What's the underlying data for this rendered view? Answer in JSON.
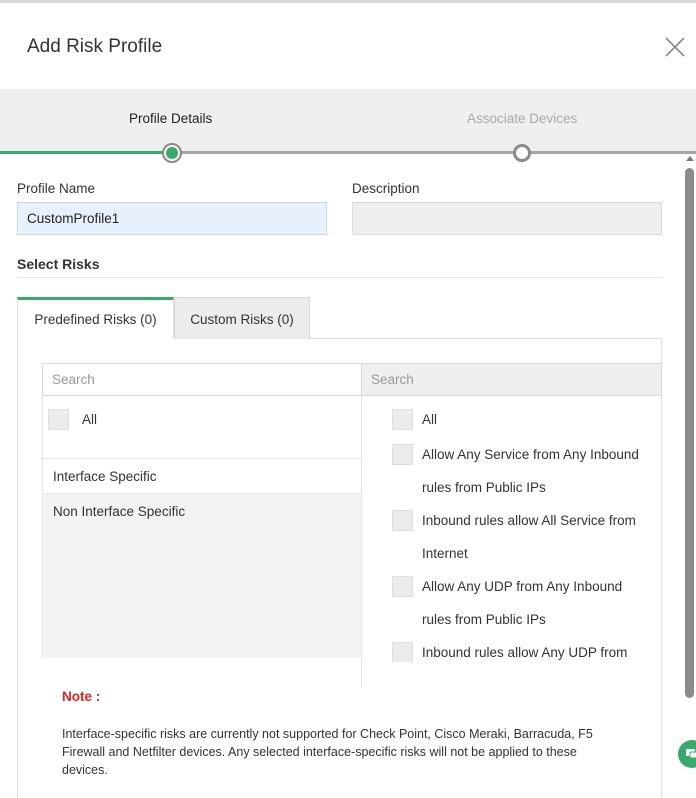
{
  "dialog": {
    "title": "Add Risk Profile"
  },
  "stepper": {
    "steps": [
      {
        "label": "Profile Details"
      },
      {
        "label": "Associate Devices"
      }
    ]
  },
  "form": {
    "profile_name_label": "Profile Name",
    "profile_name_value": "CustomProfile1",
    "description_label": "Description",
    "description_value": ""
  },
  "select_risks": {
    "title": "Select Risks",
    "tabs": [
      {
        "label": "Predefined Risks (0)"
      },
      {
        "label": "Custom Risks (0)"
      }
    ],
    "left": {
      "search_placeholder": "Search",
      "all_label": "All",
      "categories": [
        "Interface Specific",
        "Non Interface Specific"
      ]
    },
    "right": {
      "search_placeholder": "Search",
      "all_label": "All",
      "risks": [
        "Allow Any Service from Any Inbound rules from Public IPs",
        "Inbound rules allow All Service from Internet",
        "Allow Any UDP from Any Inbound rules from Public IPs",
        "Inbound rules allow Any UDP from"
      ]
    }
  },
  "note": {
    "title": "Note :",
    "text": "Interface-specific risks are currently not supported for Check Point, Cisco Meraki, Barracuda, F5 Firewall and Netfilter devices. Any selected interface-specific risks will not be applied to these devices."
  },
  "colors": {
    "accent": "#3aaa6c",
    "note_title": "#e02020"
  },
  "icons": [
    "close-icon",
    "chat-icon"
  ]
}
